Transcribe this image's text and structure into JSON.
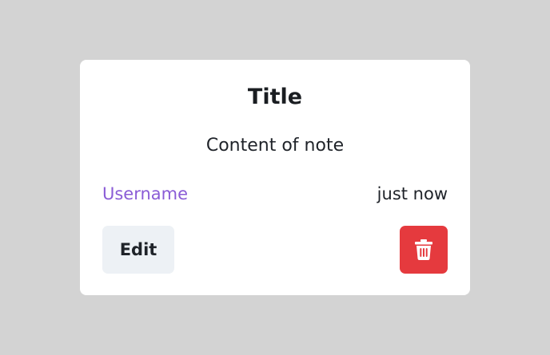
{
  "note": {
    "title": "Title",
    "content": "Content of note",
    "username": "Username",
    "timestamp": "just now",
    "edit_label": "Edit",
    "delete_icon": "trash-icon"
  },
  "colors": {
    "background": "#d3d3d3",
    "card": "#ffffff",
    "username": "#8a5cd6",
    "edit_button": "#edf1f5",
    "delete_button": "#e53a3e"
  }
}
